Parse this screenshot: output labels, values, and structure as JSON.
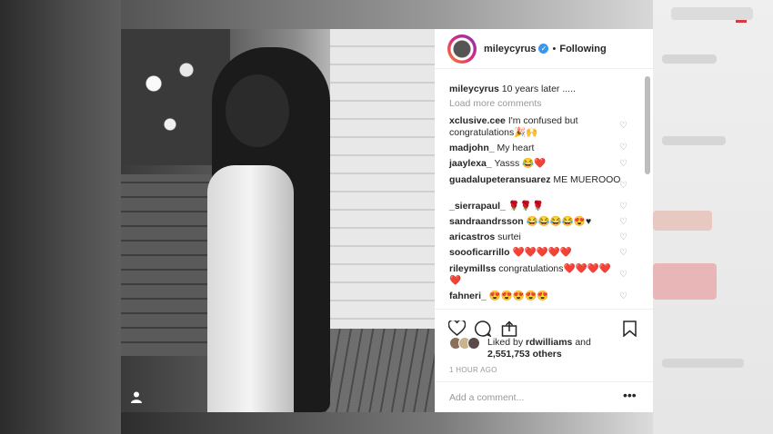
{
  "post": {
    "username": "mileycyrus",
    "follow_label": "Following",
    "caption_user": "mileycyrus",
    "caption_text": "10 years later .....",
    "load_more": "Load more comments",
    "comments": [
      {
        "user": "xclusive.cee",
        "text": "I'm confused but congratulations🎉🙌"
      },
      {
        "user": "madjohn_",
        "text": "My heart"
      },
      {
        "user": "jaaylexa_",
        "text": "Yasss 😂❤️"
      },
      {
        "user": "guadalupeteransuarez",
        "text": "ME MUEROOO"
      },
      {
        "user": "_sierrapaul_",
        "text": "🌹🌹🌹"
      },
      {
        "user": "sandraandrsson",
        "text": "😂😂😂😂😍♥"
      },
      {
        "user": "aricastros",
        "text": "surtei"
      },
      {
        "user": "soooficarrillo",
        "text": "❤️❤️❤️❤️❤️"
      },
      {
        "user": "rileymillss",
        "text": "congratulations❤️❤️❤️❤️❤️"
      },
      {
        "user": "fahneri_",
        "text": "😍😍😍😍😍"
      }
    ],
    "liked_by_prefix": "Liked by",
    "liked_by_user": "rdwilliams",
    "liked_by_and": "and",
    "others_count": "2,551,753 others",
    "timestamp": "1 HOUR AGO",
    "add_comment_placeholder": "Add a comment...",
    "more_label": "•••"
  },
  "icons": {
    "heart": "♡",
    "comment": "◯",
    "share": "share-icon",
    "bookmark": "bookmark-icon"
  },
  "colors": {
    "verified": "#3897f0",
    "accent_dash": "#d23a4b"
  }
}
